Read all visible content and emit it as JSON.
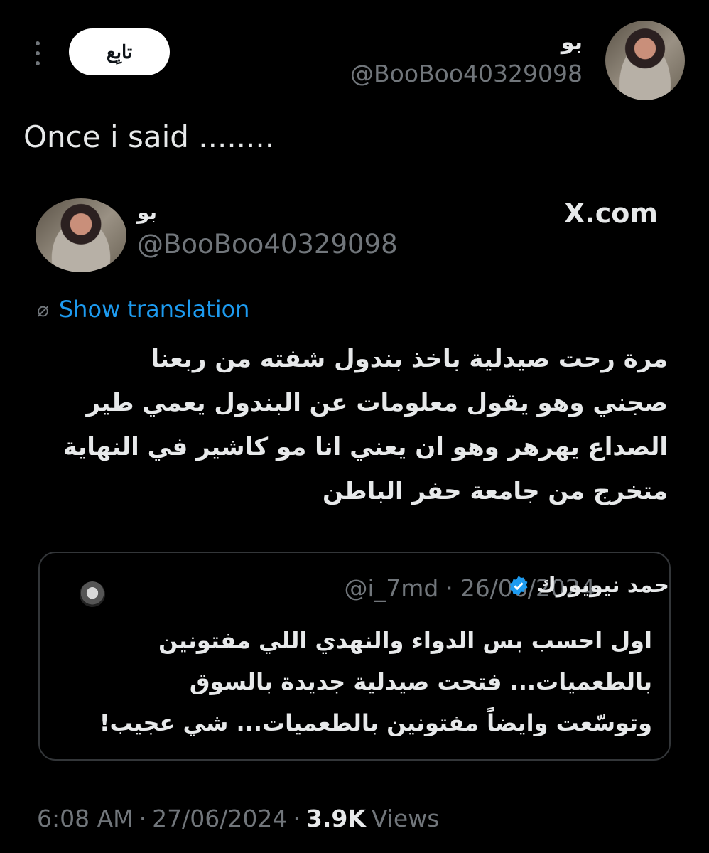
{
  "tweet": {
    "author_name": "بو",
    "author_handle": "@BooBoo40329098",
    "follow_label": "تابِع",
    "text": "Once i said ........"
  },
  "embedded_tweet": {
    "author_name": "بو",
    "author_handle": "@BooBoo40329098",
    "source_logo": "X.com",
    "show_translation_label": "Show translation",
    "body_lines": [
      "مرة رحت صيدلية باخذ بندول شفته من ربعنا",
      "صجني وهو يقول معلومات عن  البندول يعمي طير",
      "الصداع يهرهر وهو ان يعني انا مو كاشير في النهاية",
      "متخرج من جامعة حفر الباطن"
    ]
  },
  "quoted_tweet": {
    "author_name": "حمد نيويورك",
    "handle": "@i_7md",
    "separator": "·",
    "date": "26/06/2024",
    "body_lines": [
      "اول احسب بس الدواء والنهدي اللي مفتونين",
      "بالطعميات... فتحت صيدلية جديدة بالسوق",
      "وتوسّعت وايضاً مفتونين بالطعميات... شي عجيب!"
    ]
  },
  "meta": {
    "time": "6:08 AM",
    "separator": "·",
    "date": "27/06/2024",
    "views_count": "3.9K",
    "views_label": "Views"
  },
  "icons": {
    "more": "more-vertical-icon",
    "verified": "verified-badge-icon",
    "translate": "globe-slash-icon"
  },
  "colors": {
    "background": "#000000",
    "text": "#e7e9ea",
    "muted": "#71767b",
    "link": "#1d9bf0"
  }
}
